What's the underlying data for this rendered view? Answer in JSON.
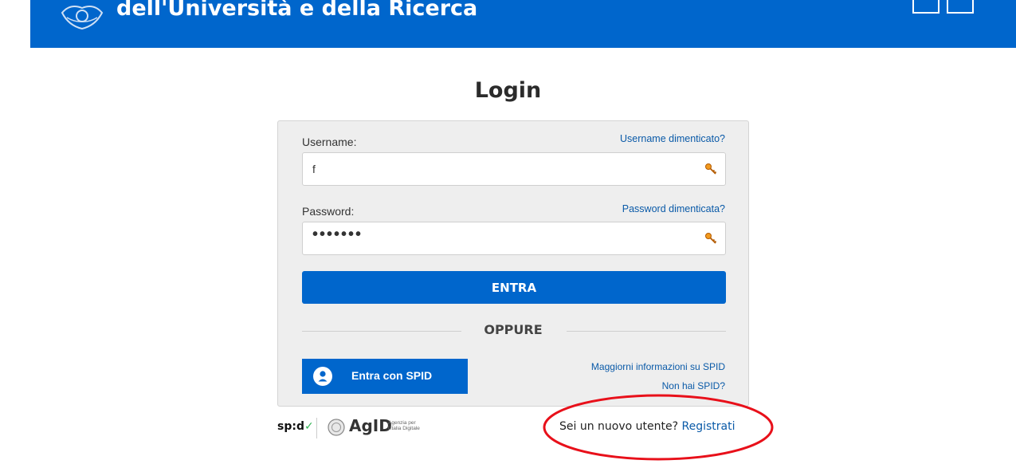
{
  "header": {
    "title": "dell'Università e della Ricerca",
    "bg_color": "#0066cc",
    "logo_icon": "emblem-icon"
  },
  "page": {
    "title": "Login"
  },
  "form": {
    "username": {
      "label": "Username:",
      "forgot_link": "Username dimenticato?",
      "value": "f",
      "icon": "key-icon"
    },
    "password": {
      "label": "Password:",
      "forgot_link": "Password dimenticata?",
      "masked_value": "•••••••",
      "icon": "key-icon"
    },
    "submit_label": "ENTRA",
    "divider_label": "OPPURE",
    "spid_button_label": "Entra con SPID",
    "spid_info_link": "Maggiorni informazioni su SPID",
    "no_spid_link": "Non hai SPID?"
  },
  "footer": {
    "spid_logo": "sp:d",
    "agid_logo": "AgID",
    "agid_subtitle_1": "Agenzia per",
    "agid_subtitle_2": "l'Italia Digitale",
    "new_user_text": "Sei un nuovo utente?",
    "register_link": "Registrati"
  },
  "annotation": {
    "color": "#e8101a"
  }
}
